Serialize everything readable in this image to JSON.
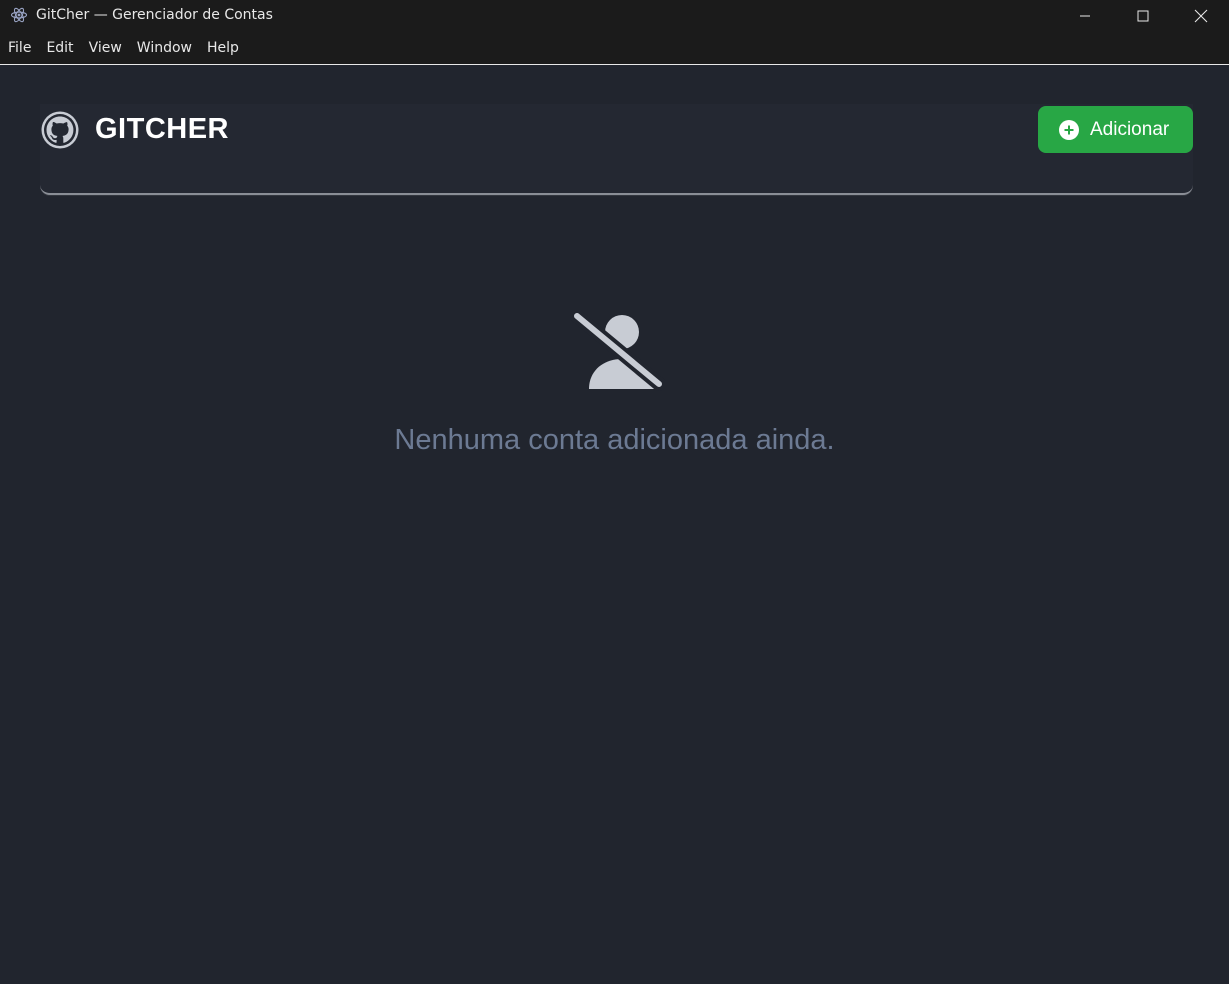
{
  "window": {
    "title": "GitCher — Gerenciador de Contas",
    "icons": {
      "app": "electron-icon",
      "minimize": "minimize-icon",
      "maximize": "maximize-icon",
      "close": "close-icon"
    }
  },
  "menubar": {
    "items": [
      {
        "label": "File"
      },
      {
        "label": "Edit"
      },
      {
        "label": "View"
      },
      {
        "label": "Window"
      },
      {
        "label": "Help"
      }
    ]
  },
  "header": {
    "brand": "GITCHER",
    "logo_icon": "github-icon",
    "add_button": {
      "label": "Adicionar",
      "icon": "plus-circle-icon",
      "color": "#28a745"
    }
  },
  "empty_state": {
    "icon": "user-slash-icon",
    "message": "Nenhuma conta adicionada ainda."
  },
  "colors": {
    "background": "#21252e",
    "titlebar": "#1b1b1b",
    "accent": "#28a745",
    "muted_text": "#6c7a93",
    "icon_gray": "#c8ccd4"
  }
}
